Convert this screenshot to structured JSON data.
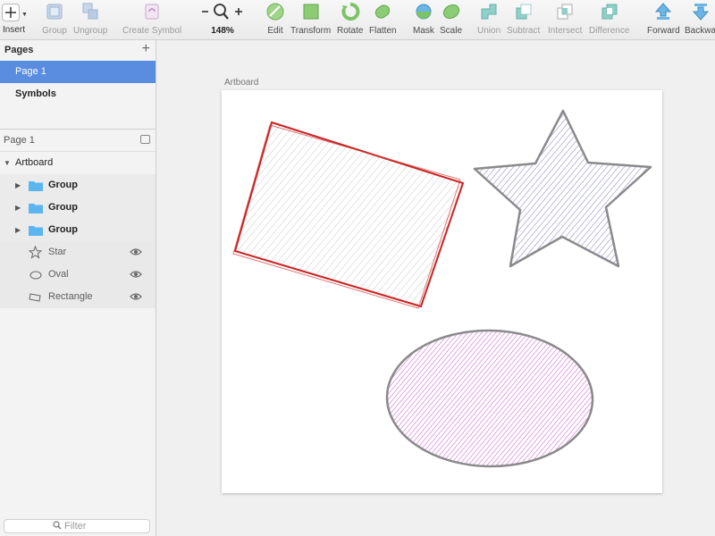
{
  "toolbar": {
    "insert": "Insert",
    "group": "Group",
    "ungroup": "Ungroup",
    "create_symbol": "Create Symbol",
    "zoom_level": "148%",
    "edit": "Edit",
    "transform": "Transform",
    "rotate": "Rotate",
    "flatten": "Flatten",
    "mask": "Mask",
    "scale": "Scale",
    "union": "Union",
    "subtract": "Subtract",
    "intersect": "Intersect",
    "difference": "Difference",
    "forward": "Forward",
    "backward": "Backwa"
  },
  "pages": {
    "title": "Pages",
    "items": [
      {
        "label": "Page 1",
        "selected": true
      },
      {
        "label": "Symbols",
        "selected": false
      }
    ]
  },
  "layers": {
    "page_label": "Page 1",
    "artboard": "Artboard",
    "items": [
      {
        "label": "Group",
        "icon": "folder-icon"
      },
      {
        "label": "Group",
        "icon": "folder-icon"
      },
      {
        "label": "Group",
        "icon": "folder-icon"
      },
      {
        "label": "Star",
        "icon": "star-outline-icon"
      },
      {
        "label": "Oval",
        "icon": "oval-outline-icon"
      },
      {
        "label": "Rectangle",
        "icon": "rectangle-outline-icon"
      }
    ]
  },
  "filter": {
    "placeholder": "Filter"
  },
  "canvas": {
    "artboard_label": "Artboard"
  },
  "colors": {
    "selection": "#5a8de0",
    "rect_stroke": "#cc2222",
    "star_fill": "#6a64b8",
    "oval_fill": "#c040c8",
    "folder": "#5bb5f0"
  }
}
